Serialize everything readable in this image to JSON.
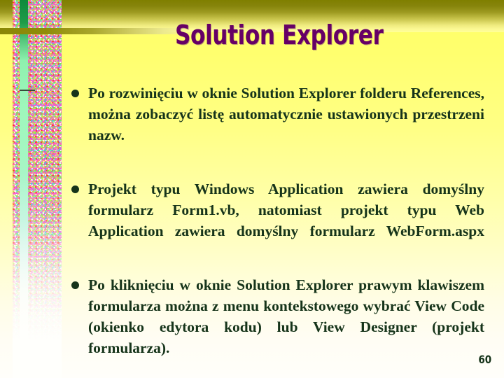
{
  "slide": {
    "title": "Solution Explorer",
    "page_number": "60",
    "colors": {
      "background_top": "#FFFF66",
      "background_bottom": "#FFFEFA",
      "band_olive": "#7F7F00",
      "title_purple": "#660066",
      "body_green": "#16341A",
      "stripe_green": "#8EF0AE"
    },
    "bullets": [
      {
        "marker": "bullet-dot",
        "text": "Po rozwinięciu w oknie Solution Explorer folderu References, można zobaczyć listę automatycznie ustawionych przestrzeni nazw."
      },
      {
        "marker": "bullet-dot",
        "text": "Projekt typu Windows Application zawiera domyślny formularz  Form1.vb, natomiast projekt typu Web Application zawiera domyślny formularz WebForm.aspx"
      },
      {
        "marker": "bullet-dot",
        "text": "Po kliknięciu w oknie Solution Explorer prawym klawiszem formularza można z menu kontekstowego wybrać View Code (okienko edytora kodu) lub View Designer (projekt formularza)."
      }
    ],
    "decor": {
      "sidebar_name": "confetti-texture-band",
      "stripe_name": "green-vertical-stripe",
      "top_band_name": "olive-header-band",
      "rule_name": "olive-horizontal-rule"
    }
  }
}
